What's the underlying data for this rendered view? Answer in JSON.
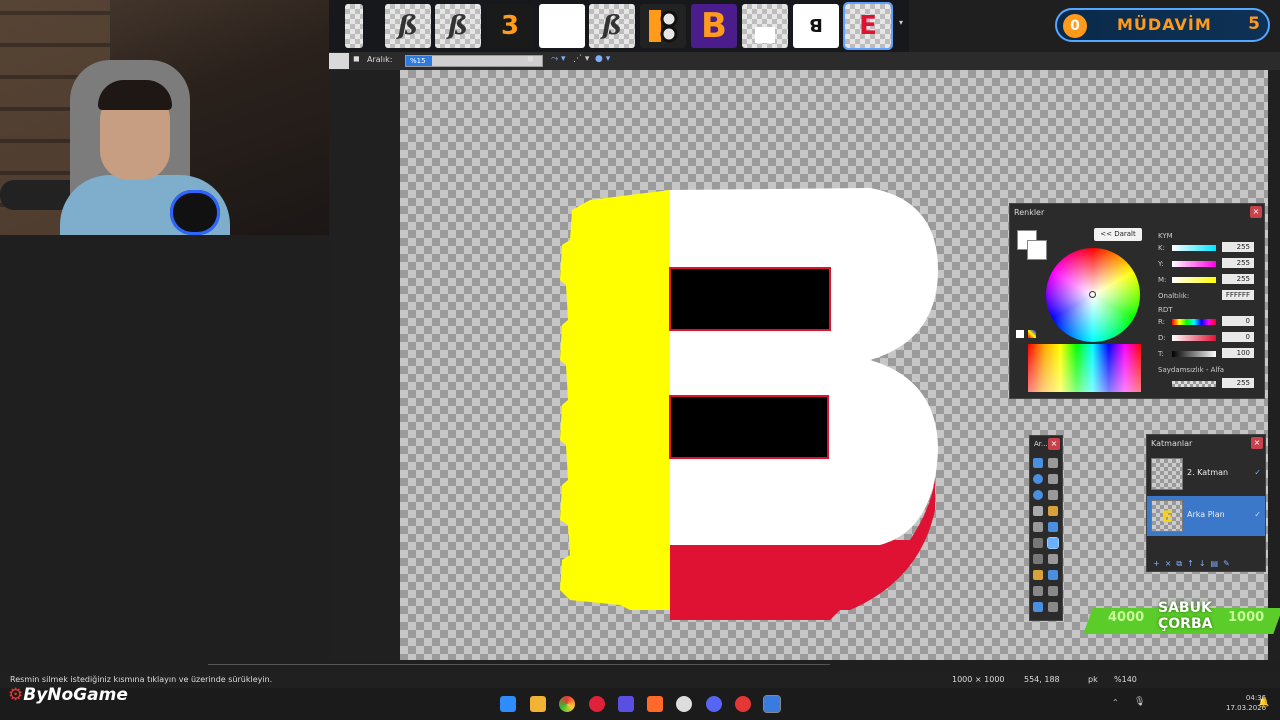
{
  "toolbar": {
    "spacing_label": "Aralık:",
    "zoom_value": "%15"
  },
  "thumbnails": [
    {
      "name": "thumb-1",
      "glyph": ""
    },
    {
      "name": "thumb-2",
      "glyph": "ß"
    },
    {
      "name": "thumb-3",
      "glyph": "ß"
    },
    {
      "name": "thumb-4",
      "glyph": "3"
    },
    {
      "name": "thumb-5",
      "glyph": ""
    },
    {
      "name": "thumb-6",
      "glyph": "ß"
    },
    {
      "name": "thumb-7",
      "glyph": ""
    },
    {
      "name": "thumb-8",
      "glyph": "B"
    },
    {
      "name": "thumb-9",
      "glyph": ""
    },
    {
      "name": "thumb-10",
      "glyph": "ꓭ"
    },
    {
      "name": "thumb-11",
      "glyph": "E"
    }
  ],
  "overlay": {
    "badge_number": "0",
    "badge_text": "MÜDAVİM",
    "badge_right_number": "5",
    "corba_left": "4000",
    "corba_title_1": "SABUK",
    "corba_title_2": "ÇORBA",
    "corba_right": "1000"
  },
  "colors_panel": {
    "title": "Renkler",
    "collapse_button": "<< Daralt",
    "cmy_label": "KYM",
    "k_label": "K:",
    "k_value": "255",
    "y_label": "Y:",
    "y_value": "255",
    "m_label": "M:",
    "m_value": "255",
    "hex_label": "Onaltılık:",
    "hex_value": "FFFFFF",
    "rgb_label": "RDT",
    "r_label": "R:",
    "r_value": "0",
    "d_label": "D:",
    "d_value": "0",
    "t_label": "T:",
    "t_value": "100",
    "alpha_label": "Saydamsızlık - Alfa",
    "alpha_value": "255"
  },
  "tools_panel": {
    "title": "Ar..."
  },
  "layers_panel": {
    "title": "Katmanlar",
    "layers": [
      {
        "name": "2. Katman",
        "selected": false
      },
      {
        "name": "Arka Plan",
        "selected": true
      }
    ]
  },
  "status": {
    "hint": "Resmin silmek istediğiniz kısmına tıklayın ve üzerinde sürükleyin.",
    "image_size": "1000 × 1000",
    "cursor_pos": "554, 188",
    "unit": "pk",
    "zoom": "%140"
  },
  "taskbar": {
    "brand": "ByNoGame",
    "time": "04:36",
    "date": "17.03.2026"
  },
  "colors": {
    "yellow": "#ffff00",
    "red": "#e01234",
    "accent": "#2d7be0",
    "badge_orange": "#ff9a1a",
    "corba_green": "#5ccc2b"
  }
}
